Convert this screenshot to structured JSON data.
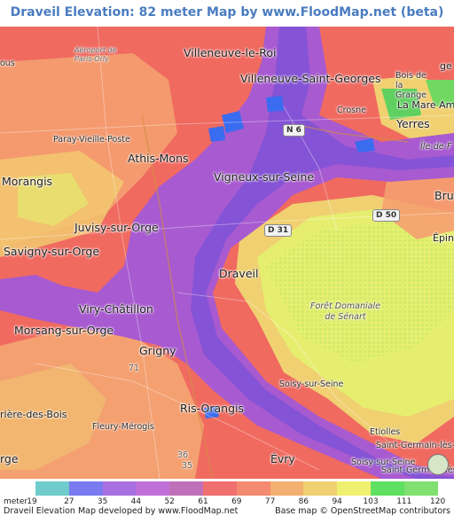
{
  "title": "Draveil Elevation: 82 meter Map by www.FloodMap.net (beta)",
  "colors": {
    "title": "#4a7cc0",
    "low_terrain": "#f06a60",
    "mid_terrain": "#f4a070",
    "high_terrain": "#f0e070",
    "plateau": "#e6f070",
    "river_band": "#a85ad0",
    "river_core": "#7a52d8",
    "water": "#3a6cf0",
    "forest_green": "#60d060"
  },
  "places": [
    {
      "name": "Villeneuve-le-Roi",
      "size": "big"
    },
    {
      "name": "Villeneuve-Saint-Georges",
      "size": "big"
    },
    {
      "name": "Paray-Vieille-Poste",
      "size": "small"
    },
    {
      "name": "Athis-Mons",
      "size": "big"
    },
    {
      "name": "Vigneux-sur-Seine",
      "size": "big"
    },
    {
      "name": "Morangis",
      "size": "big"
    },
    {
      "name": "Juvisy-sur-Orge",
      "size": "big"
    },
    {
      "name": "Savigny-sur-Orge",
      "size": "big"
    },
    {
      "name": "Draveil",
      "size": "big"
    },
    {
      "name": "Viry-Châtillon",
      "size": "big"
    },
    {
      "name": "Morsang-sur-Orge",
      "size": "big"
    },
    {
      "name": "Grigny",
      "size": "big"
    },
    {
      "name": "Ris-Orangis",
      "size": "big"
    },
    {
      "name": "Soisy-sur-Seine",
      "size": "small"
    },
    {
      "name": "Fleury-Mérogis",
      "size": "small"
    },
    {
      "name": "Évry",
      "size": "big"
    },
    {
      "name": "Etiolles",
      "size": "small"
    },
    {
      "name": "Crosne",
      "size": "small"
    },
    {
      "name": "Yerres",
      "size": "big"
    },
    {
      "name": "La Mare Am",
      "size": "mid"
    },
    {
      "name": "Bois de la Grange",
      "size": "small"
    },
    {
      "name": "Île-de-F",
      "size": "small"
    },
    {
      "name": "Bru",
      "size": "big"
    },
    {
      "name": "Épin",
      "size": "mid"
    },
    {
      "name": "Saint-Germain-lès-Corbeil",
      "size": "small"
    },
    {
      "name": "Saint-Germain-lès-Co",
      "size": "small"
    },
    {
      "name": "Soisy-sur-Seine",
      "size": "small"
    },
    {
      "name": "rge",
      "size": "big"
    },
    {
      "name": "ous",
      "size": "small"
    },
    {
      "name": "rière-des-Bois",
      "size": "mid"
    },
    {
      "name": "Aéroport de Paris-Orly",
      "size": "small"
    },
    {
      "name": "ge",
      "size": "mid"
    }
  ],
  "forest_label": "Forêt Domaniale\nde Sénart",
  "roads": [
    "N 6",
    "D 31",
    "D 50",
    "71",
    "36",
    "35"
  ],
  "legend": {
    "unit_label": "meter",
    "values": [
      "19",
      "27",
      "35",
      "44",
      "52",
      "61",
      "69",
      "77",
      "86",
      "94",
      "103",
      "111",
      "120"
    ],
    "swatch_colors": [
      "#70cccc",
      "#7a7af0",
      "#a870e0",
      "#c070d8",
      "#c070b8",
      "#f07070",
      "#f48a70",
      "#f4b070",
      "#f0d070",
      "#f0f070",
      "#60e060",
      "#80e070"
    ]
  },
  "credits": {
    "left": "Draveil Elevation Map developed by www.FloodMap.net",
    "right": "Base map © OpenStreetMap contributors"
  }
}
